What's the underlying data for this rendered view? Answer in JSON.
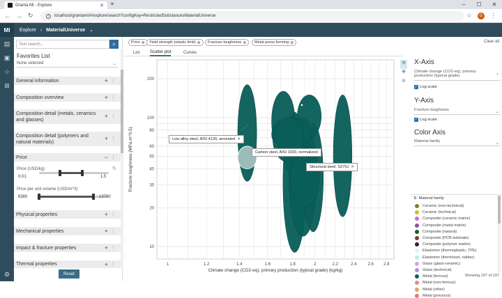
{
  "browser": {
    "tab_title": "Granta MI - Explore",
    "url": "localhost/grantami/#/explore/search?configKey=RestrictedSubstancesMaterialUniverse"
  },
  "app": {
    "logo": "MI",
    "breadcrumb_root": "Explore",
    "breadcrumb_current": "MaterialUniverse"
  },
  "left": {
    "search_placeholder": "Text search...",
    "favorites_label": "Favorites List",
    "favorites_value": "None selected",
    "sections": [
      {
        "label": "General information"
      },
      {
        "label": "Composition overview"
      },
      {
        "label": "Composition detail (metals, ceramics and glasses)"
      },
      {
        "label": "Composition detail (polymers and natural materials)"
      },
      {
        "label": "Price"
      },
      {
        "label": "Physical properties"
      },
      {
        "label": "Mechanical properties"
      },
      {
        "label": "Impact & fracture properties"
      },
      {
        "label": "Thermal properties"
      }
    ],
    "price_label": "Price (USD/kg)",
    "price_min": "0.01",
    "price_max": "1.5",
    "price_min_frac": 0.0,
    "price_low_frac": 0.3,
    "price_high_frac": 0.62,
    "ppuv_label": "Price per unit volume (USD/m^3)",
    "ppuv_min": "8380",
    "ppuv_max": "13700",
    "ppuv_low_frac": 0.0,
    "ppuv_high_frac": 0.78,
    "reset_label": "Reset"
  },
  "filters": [
    "Price",
    "Yield strength (elastic limit)",
    "Fracture toughness",
    "Metal press forming"
  ],
  "clear_all": "Clear all",
  "view_tabs": [
    "List",
    "Scatter plot",
    "Curves"
  ],
  "active_view": "Scatter plot",
  "right": {
    "x_title": "X-Axis",
    "x_value": "Climate change (CO2-eq), primary production (typical grade)",
    "x_log": "Log scale",
    "y_title": "Y-Axis",
    "y_value": "Fracture toughness",
    "y_log": "Log scale",
    "c_title": "Color Axis",
    "c_value": "Material family",
    "legend_header": "Material family",
    "legend": [
      {
        "name": "Ceramic (non-technical)",
        "color": "#8a7a2e"
      },
      {
        "name": "Ceramic (technical)",
        "color": "#c5c51a"
      },
      {
        "name": "Composite (ceramic matrix)",
        "color": "#d36ad3"
      },
      {
        "name": "Composite (metal matrix)",
        "color": "#8a4fa8"
      },
      {
        "name": "Composite (natural)",
        "color": "#1e5e1e"
      },
      {
        "name": "Composite (PCB laminate)",
        "color": "#6a4a2a"
      },
      {
        "name": "Composite (polymer matrix)",
        "color": "#3b1a3b"
      },
      {
        "name": "Elastomer (thermoplastic, TPE)",
        "color": "#d4f7f7"
      },
      {
        "name": "Elastomer (thermoset, rubber)",
        "color": "#b7e9e9"
      },
      {
        "name": "Glass (glass-ceramic)",
        "color": "#c7a9e3"
      },
      {
        "name": "Glass (technical)",
        "color": "#b58fd8"
      },
      {
        "name": "Metal (ferrous)",
        "color": "#0a5e5a"
      },
      {
        "name": "Metal (non-ferrous)",
        "color": "#e58a8a"
      },
      {
        "name": "Metal (other)",
        "color": "#e0a46a"
      },
      {
        "name": "Metal (precious)",
        "color": "#e07a7a"
      }
    ],
    "showing": "Showing 197 of 197"
  },
  "chart_data": {
    "type": "scatter",
    "xlabel": "Climate change (CO2-eq), primary production (typical grade) (kg/kg)",
    "ylabel": "Fracture toughness (MPa.m^0.5)",
    "xscale": "log",
    "yscale": "log",
    "xlim": [
      0.95,
      2.9
    ],
    "ylim": [
      8,
      280
    ],
    "x_ticks": [
      "1",
      "1.2",
      "1.4",
      "1.6",
      "1.8",
      "2",
      "2.2",
      "2.4",
      "2.6",
      "2.8"
    ],
    "y_ticks": [
      "10",
      "20",
      "30",
      "40",
      "50",
      "60",
      "80",
      "100",
      "200"
    ],
    "grid": true,
    "series": [
      {
        "name": "Metal (ferrous)",
        "color": "#0a5e5a",
        "ellipses": [
          {
            "x": [
              1.39,
              1.52
            ],
            "y": [
              32,
              180
            ]
          },
          {
            "x": [
              1.72,
              1.92
            ],
            "y": [
              9,
              110
            ]
          },
          {
            "x": [
              1.77,
              2.02
            ],
            "y": [
              12,
              100
            ]
          },
          {
            "x": [
              1.89,
              2.08
            ],
            "y": [
              13,
              90
            ]
          },
          {
            "x": [
              1.63,
              1.82
            ],
            "y": [
              55,
              160
            ]
          },
          {
            "x": [
              1.84,
              2.06
            ],
            "y": [
              70,
              150
            ]
          },
          {
            "x": [
              1.63,
              1.96
            ],
            "y": [
              55,
              100
            ]
          },
          {
            "x": [
              1.73,
              1.97
            ],
            "y": [
              35,
              70
            ]
          },
          {
            "x": [
              2.18,
              2.38
            ],
            "y": [
              17,
              150
            ]
          },
          {
            "x": [
              1.78,
              2.04
            ],
            "y": [
              20,
              60
            ]
          },
          {
            "x": [
              1.64,
              1.9
            ],
            "y": [
              45,
              100
            ]
          }
        ]
      }
    ],
    "highlight": {
      "x": [
        1.39,
        1.52
      ],
      "y": [
        40,
        60
      ]
    },
    "annotations": [
      {
        "text": "Low alloy steel, AISI 4130, annealed",
        "x": 1.43,
        "y": 72
      },
      {
        "text": "Carbon steel, AISI 1020, normalized",
        "x": 1.45,
        "y": 52
      },
      {
        "text": "Structural steel, S275J",
        "x": 2.02,
        "y": 39
      }
    ]
  }
}
